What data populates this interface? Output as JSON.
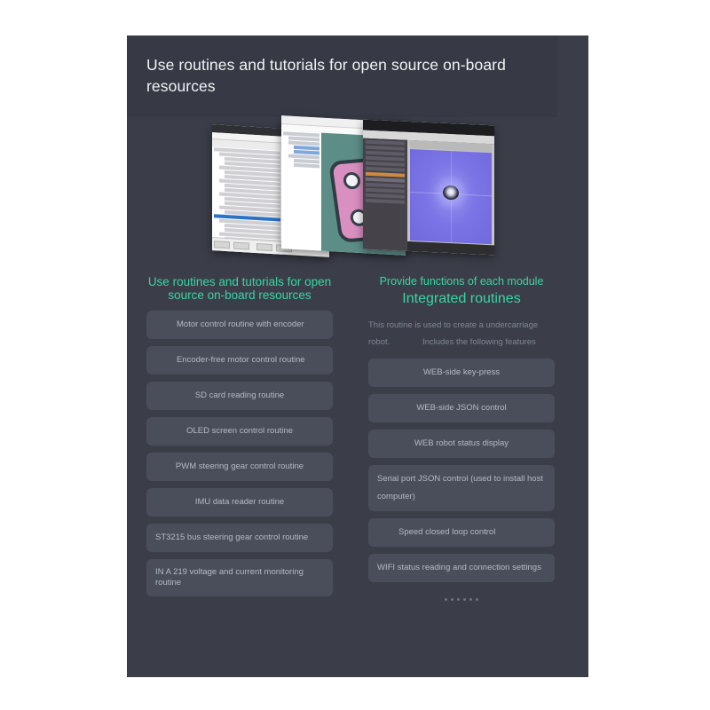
{
  "panel": {
    "title": "Use routines and tutorials for open source on-board resources"
  },
  "screenshots": {
    "window_1_name": "schematic-netlist-editor-screenshot",
    "window_2_name": "pcb-layout-editor-screenshot",
    "window_3_name": "3d-render-viewport-screenshot"
  },
  "left_column": {
    "heading": "Use routines and tutorials for open source on-board resources",
    "features": [
      {
        "label": "Motor control routine with encoder",
        "align": "indent"
      },
      {
        "label": "Encoder-free motor control routine",
        "align": "indent"
      },
      {
        "label": "SD card reading routine",
        "align": "center"
      },
      {
        "label": "OLED screen control routine",
        "align": "center"
      },
      {
        "label": "PWM steering gear control routine",
        "align": "center"
      },
      {
        "label": "IMU data reader routine",
        "align": "center"
      },
      {
        "label": "ST3215 bus steering gear control routine",
        "align": "left"
      },
      {
        "label": "IN A 219 voltage and current monitoring routine",
        "align": "tight"
      }
    ]
  },
  "right_column": {
    "heading_small": "Provide functions of each module",
    "heading_big": "Integrated routines",
    "description_line1": "This routine is used to create a undercarriage",
    "description_line2": "robot.",
    "description_line3": "Includes the following features",
    "features": [
      {
        "label": "WEB-side key-press",
        "align": "center"
      },
      {
        "label": "WEB-side JSON control",
        "align": "center"
      },
      {
        "label": "WEB robot status display",
        "align": "center"
      },
      {
        "label": "Serial port JSON control (used to install host computer)",
        "align": "left"
      },
      {
        "label": "Speed closed loop control",
        "align": "indent"
      },
      {
        "label": "WIFI status reading and connection settings",
        "align": "left"
      }
    ],
    "pagination_dots": 6
  },
  "colors": {
    "page_background": "#ffffff",
    "panel_background": "#3b3e49",
    "title_band": "#373a45",
    "accent_teal": "#3cd4a4",
    "feature_card": "#4a4e5b",
    "feature_text": "#b5bac5",
    "description_text": "#7e8694",
    "title_text": "#f2f3f5"
  }
}
